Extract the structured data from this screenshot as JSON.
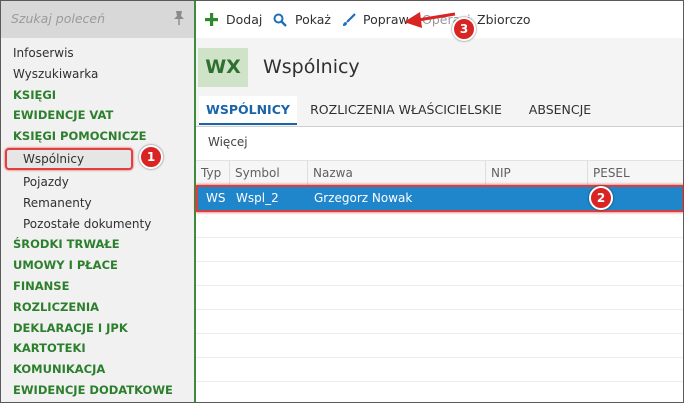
{
  "sidebar": {
    "search_placeholder": "Szukaj poleceń",
    "items": [
      {
        "label": "Infoserwis",
        "level": 0,
        "green": false
      },
      {
        "label": "Wyszukiwarka",
        "level": 0,
        "green": false
      },
      {
        "label": "KSIĘGI",
        "level": 0,
        "green": true
      },
      {
        "label": "EWIDENCJE VAT",
        "level": 0,
        "green": true
      },
      {
        "label": "KSIĘGI POMOCNICZE",
        "level": 0,
        "green": true
      },
      {
        "label": "Wspólnicy",
        "level": 1,
        "green": false,
        "selected": true
      },
      {
        "label": "Pojazdy",
        "level": 1,
        "green": false
      },
      {
        "label": "Remanenty",
        "level": 1,
        "green": false
      },
      {
        "label": "Pozostałe dokumenty",
        "level": 1,
        "green": false
      },
      {
        "label": "ŚRODKI TRWAŁE",
        "level": 0,
        "green": true
      },
      {
        "label": "UMOWY I PŁACE",
        "level": 0,
        "green": true
      },
      {
        "label": "FINANSE",
        "level": 0,
        "green": true
      },
      {
        "label": "ROZLICZENIA",
        "level": 0,
        "green": true
      },
      {
        "label": "DEKLARACJE I JPK",
        "level": 0,
        "green": true
      },
      {
        "label": "KARTOTEKI",
        "level": 0,
        "green": true
      },
      {
        "label": "KOMUNIKACJA",
        "level": 0,
        "green": true
      },
      {
        "label": "EWIDENCJE DODATKOWE",
        "level": 0,
        "green": true
      }
    ]
  },
  "toolbar": {
    "add_label": "Dodaj",
    "show_label": "Pokaż",
    "edit_label": "Popraw",
    "hidden_label": "Operacje",
    "bulk_label": "Zbiorczo"
  },
  "header": {
    "badge": "WX",
    "title": "Wspólnicy"
  },
  "tabs": [
    {
      "label": "WSPÓLNICY",
      "active": true
    },
    {
      "label": "ROZLICZENIA WŁAŚCICIELSKIE",
      "active": false
    },
    {
      "label": "ABSENCJE",
      "active": false
    }
  ],
  "more_label": "Więcej",
  "table": {
    "columns": [
      "Typ",
      "Symbol",
      "Nazwa",
      "NIP",
      "PESEL"
    ],
    "rows": [
      {
        "typ": "WS",
        "symbol": "Wspl_2",
        "nazwa": "Grzegorz Nowak",
        "nip": "",
        "pesel": ""
      }
    ]
  },
  "callouts": [
    "1",
    "2",
    "3"
  ],
  "colors": {
    "accent_green": "#2c7f2c",
    "selection_blue": "#1f86cc",
    "tab_blue": "#1a64a8",
    "annotation_red": "#d92424"
  }
}
